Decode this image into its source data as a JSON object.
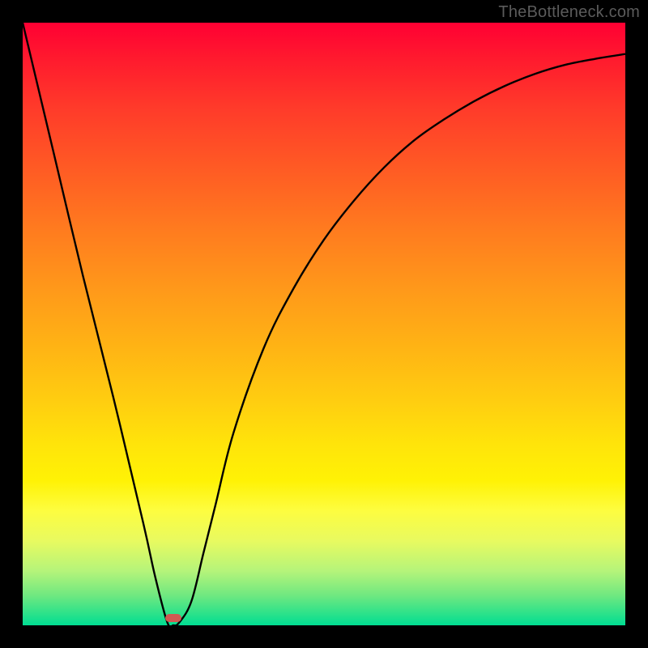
{
  "watermark": "TheBottleneck.com",
  "chart_data": {
    "type": "line",
    "title": "",
    "xlabel": "",
    "ylabel": "",
    "xlim": [
      0,
      100
    ],
    "ylim": [
      0,
      100
    ],
    "legend": false,
    "grid": false,
    "background_gradient": {
      "top": "#ff0033",
      "bottom": "#00dd92",
      "description": "vertical red-orange-yellow-green gradient"
    },
    "series": [
      {
        "name": "bottleneck-curve",
        "x": [
          0,
          5,
          10,
          15,
          20,
          22,
          24,
          25,
          26,
          28,
          30,
          32,
          35,
          40,
          45,
          50,
          55,
          60,
          65,
          70,
          75,
          80,
          85,
          90,
          95,
          100
        ],
        "y": [
          100,
          79,
          58,
          38,
          17,
          8,
          0.5,
          0,
          0.5,
          4,
          12,
          20,
          32,
          46,
          56,
          64,
          70.5,
          76,
          80.5,
          84,
          87,
          89.5,
          91.5,
          93,
          94,
          94.8
        ]
      }
    ],
    "marker": {
      "x": 25,
      "y": 0,
      "color": "#cf5a52",
      "shape": "pill"
    }
  },
  "colors": {
    "frame": "#000000",
    "curve": "#000000",
    "marker": "#cf5a52"
  }
}
